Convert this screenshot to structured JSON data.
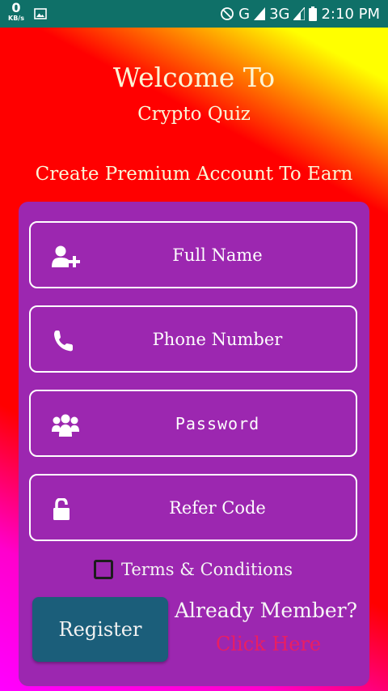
{
  "status_bar": {
    "speed_value": "0",
    "speed_unit": "KB/s",
    "network_g": "G",
    "network_3g": "3G",
    "time": "2:10 PM"
  },
  "header": {
    "welcome": "Welcome To",
    "app_name": "Crypto Quiz",
    "subtitle": "Create Premium Account To Earn"
  },
  "form": {
    "fields": [
      {
        "label": "Full Name",
        "icon": "add-user-icon"
      },
      {
        "label": "Phone Number",
        "icon": "phone-icon"
      },
      {
        "label": "Password",
        "icon": "group-icon"
      },
      {
        "label": "Refer Code",
        "icon": "unlock-icon"
      }
    ],
    "terms_label": "Terms & Conditions",
    "terms_checked": false,
    "register_label": "Register",
    "already_member": "Already Member?",
    "click_here": "Click Here"
  },
  "colors": {
    "status_bar": "#0f7068",
    "card": "#9c27b0",
    "register_button": "#1b5e7a",
    "click_here": "#e91e63",
    "header_text": "#fbf5d6"
  }
}
